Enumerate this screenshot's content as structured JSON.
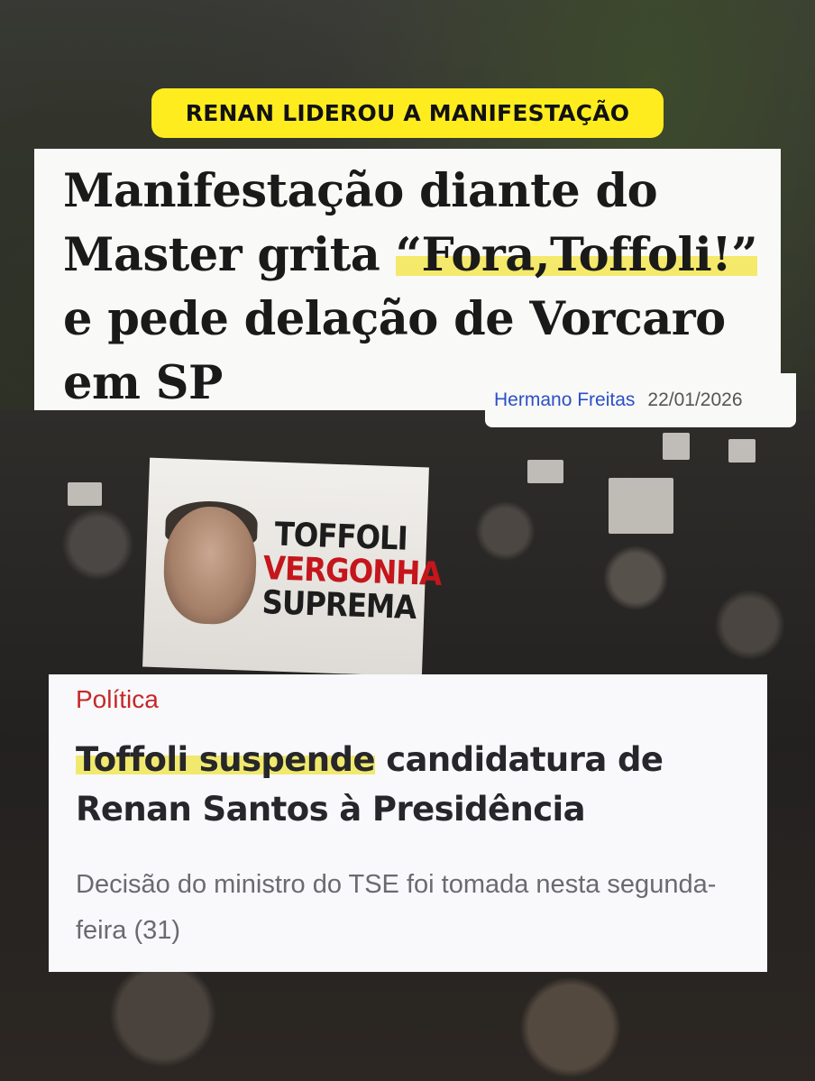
{
  "tag": {
    "text": "RENAN LIDEROU A MANIFESTAÇÃO"
  },
  "article1": {
    "headline_before": "Manifestação diante do Master grita ",
    "headline_highlight": "“Fora,Toffoli!”",
    "headline_after": " e pede delação de Vorcaro em SP",
    "author": "Hermano Freitas",
    "date": "22/01/2026"
  },
  "banner": {
    "line1": "TOFFOLI",
    "line2": "VERGONHA",
    "line3": "SUPREMA"
  },
  "article2": {
    "category": "Política",
    "headline_highlight": "Toffoli suspende",
    "headline_rest": " candidatura de Renan Santos à Presidência",
    "summary": "Decisão do ministro do TSE foi tomada nesta segunda-feira (31)"
  },
  "colors": {
    "tag_bg": "#ffec1f",
    "highlight": "#f4e96a",
    "author_link": "#2b4fc7",
    "category_red": "#c62828",
    "banner_red": "#c4161c"
  }
}
